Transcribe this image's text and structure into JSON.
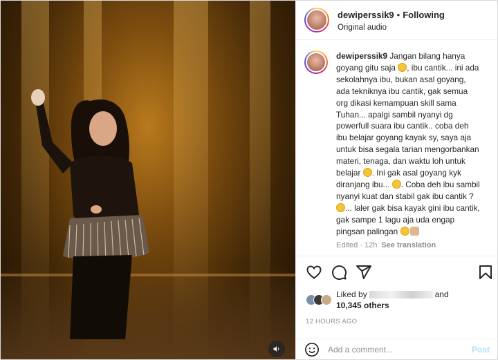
{
  "header": {
    "username": "dewiperssik9",
    "separator": "•",
    "follow_status": "Following",
    "audio": "Original audio"
  },
  "caption": {
    "username": "dewiperssik9",
    "text_1": " Jangan bilang hanya goyang gitu saja ",
    "text_2": ", ibu cantik... ini ada sekolahnya ibu, bukan asal goyang, ada tekniknya ibu cantik, gak semua org dikasi kemampuan skill sama Tuhan... apalgi sambil nyanyi dg powerfull suara ibu cantik.. coba deh ibu belajar goyang kayak sy, saya aja untuk bisa segala tarian mengorbankan materi, tenaga, dan waktu loh untuk belajar ",
    "text_3": ". Ini gak asal goyang kyk diranjang ibu... ",
    "text_4": ". Coba deh ibu sambil nyanyi kuat dan stabil gak ibu cantik ? ",
    "text_5": "... laler gak bisa kayak gini ibu cantik, gak sampe 1 lagu aja uda engap pingsan palingan ",
    "edited": "Edited · 12h",
    "see_translation": "See translation"
  },
  "likes": {
    "prefix": "Liked by",
    "and": "and",
    "others": "10,345 others"
  },
  "time_ago": "12 HOURS AGO",
  "comment_box": {
    "placeholder": "Add a comment...",
    "post_label": "Post"
  },
  "icons": [
    "heart-icon",
    "comment-icon",
    "share-icon",
    "bookmark-icon",
    "emoji-icon",
    "speaker-icon"
  ],
  "colors": {
    "post_button": "#b2dffc",
    "text": "#262626",
    "muted": "#8e8e8e",
    "border": "#dbdbdb"
  }
}
